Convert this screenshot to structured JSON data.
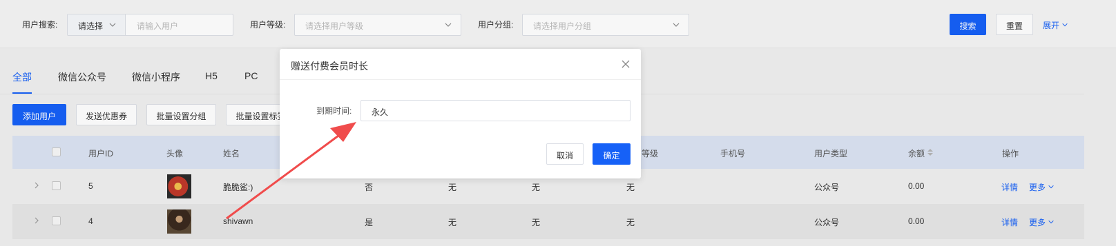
{
  "filters": {
    "user_search_label": "用户搜索:",
    "search_type_value": "请选择",
    "search_placeholder": "请输入用户",
    "level_label": "用户等级:",
    "level_placeholder": "请选择用户等级",
    "group_label": "用户分组:",
    "group_placeholder": "请选择用户分组",
    "search_button": "搜索",
    "reset_button": "重置",
    "expand_link": "展开"
  },
  "tabs": [
    "全部",
    "微信公众号",
    "微信小程序",
    "H5",
    "PC"
  ],
  "actions": {
    "add_user": "添加用户",
    "send_coupon": "发送优惠券",
    "batch_group": "批量设置分组",
    "batch_tag": "批量设置标签"
  },
  "table": {
    "headers": {
      "id": "用户ID",
      "avatar": "头像",
      "name": "姓名",
      "level": "用户等级",
      "phone": "手机号",
      "user_type": "用户类型",
      "balance": "余额",
      "operations": "操作"
    },
    "rows": [
      {
        "id": "5",
        "name": "脆脆鲨:)",
        "col_a": "否",
        "col_b": "无",
        "col_c": "无",
        "col_d": "无",
        "user_type": "公众号",
        "balance": "0.00",
        "detail": "详情",
        "more": "更多"
      },
      {
        "id": "4",
        "name": "shivawn",
        "col_a": "是",
        "col_b": "无",
        "col_c": "无",
        "col_d": "无",
        "user_type": "公众号",
        "balance": "0.00",
        "detail": "详情",
        "more": "更多"
      }
    ]
  },
  "modal": {
    "title": "赠送付费会员时长",
    "field_label": "到期时间:",
    "field_value": "永久",
    "cancel": "取消",
    "confirm": "确定"
  },
  "colors": {
    "primary": "#1661f7",
    "annotation_arrow": "#f04c4c"
  }
}
